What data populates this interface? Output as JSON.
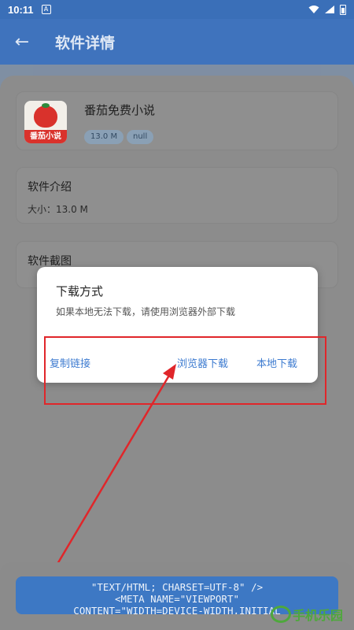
{
  "status_bar": {
    "time": "10:11",
    "notif_badge": "A"
  },
  "header": {
    "title": "软件详情"
  },
  "app": {
    "name": "番茄免费小说",
    "icon_label": "番茄小说",
    "tags": [
      "13.0 M",
      "null"
    ]
  },
  "intro": {
    "title": "软件介绍",
    "size_text": "大小：13.0 M"
  },
  "screenshots": {
    "title": "软件截图"
  },
  "dialog": {
    "title": "下载方式",
    "message": "如果本地无法下载，请使用浏览器外部下载",
    "copy_label": "复制链接",
    "browser_label": "浏览器下载",
    "local_label": "本地下载"
  },
  "code_button": {
    "lines": [
      "\"TEXT/HTML; CHARSET=UTF-8\" />",
      "<META NAME=\"VIEWPORT\"",
      "CONTENT=\"WIDTH=DEVICE-WIDTH,INITIAL"
    ]
  },
  "watermark": {
    "text": "手机乐园"
  },
  "colors": {
    "accent": "#3d7bd0",
    "highlight": "#e0262a",
    "app_bar": "#3f73bd"
  }
}
